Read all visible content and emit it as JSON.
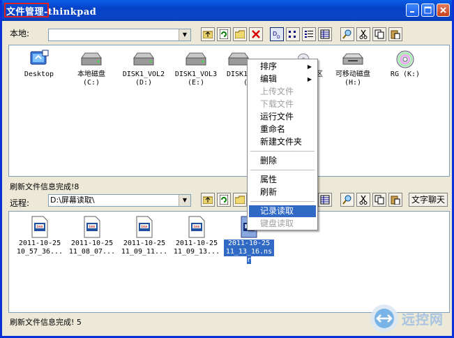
{
  "window": {
    "title_main": "文件管理",
    "title_sep": "-",
    "title_host": "thinkpad"
  },
  "local": {
    "label": "本地:",
    "path": "",
    "drives": [
      {
        "name": "Desktop",
        "letter": "",
        "icon": "desktop-icon"
      },
      {
        "name": "本地磁盘",
        "letter": "(C:)",
        "icon": "hard-drive-icon"
      },
      {
        "name": "DISK1_VOL2",
        "letter": "(D:)",
        "icon": "hard-drive-icon"
      },
      {
        "name": "DISK1_VOL3",
        "letter": "(E:)",
        "icon": "hard-drive-icon"
      },
      {
        "name": "DISK1",
        "letter": "(",
        "icon": "hard-drive-icon"
      },
      {
        "name": "区",
        "letter": "",
        "icon": "cd-drive-icon"
      },
      {
        "name": "可移动磁盘",
        "letter": "(H:)",
        "icon": "removable-drive-icon"
      },
      {
        "name": "RG (K:)",
        "letter": "",
        "icon": "cd-rom-icon"
      }
    ],
    "status": "刷新文件信息完成!8"
  },
  "remote": {
    "label": "远程:",
    "path": "D:\\屏幕读取\\",
    "chat_button": "文字聊天",
    "files": [
      {
        "line1": "2011-10-25",
        "line2": "10_57_36...",
        "line3": "",
        "selected": false
      },
      {
        "line1": "2011-10-25",
        "line2": "11_08_07...",
        "line3": "",
        "selected": false
      },
      {
        "line1": "2011-10-25",
        "line2": "11_09_11...",
        "line3": "",
        "selected": false
      },
      {
        "line1": "2011-10-25",
        "line2": "11_09_13...",
        "line3": "",
        "selected": false
      },
      {
        "line1": "2011-10-25",
        "line2": "11_13_16.ns",
        "line3": "r",
        "selected": true
      }
    ],
    "status": "刷新文件信息完成! 5"
  },
  "context_menu": {
    "items": [
      {
        "label": "排序",
        "submenu": true,
        "disabled": false
      },
      {
        "label": "编辑",
        "submenu": true,
        "disabled": false
      },
      {
        "label": "上传文件",
        "disabled": true
      },
      {
        "label": "下载文件",
        "disabled": true
      },
      {
        "label": "运行文件",
        "disabled": false
      },
      {
        "label": "重命名",
        "disabled": false
      },
      {
        "label": "新建文件夹",
        "disabled": false
      },
      {
        "label": "删除",
        "disabled": false
      },
      {
        "label": "属性",
        "disabled": false
      },
      {
        "label": "刷新",
        "disabled": false
      },
      {
        "label": "记录读取",
        "disabled": false,
        "highlighted": true
      },
      {
        "label": "键盘读取",
        "disabled": true
      }
    ]
  },
  "watermark": {
    "text": "远控网"
  },
  "colors": {
    "title_bar": "#0a4fd6",
    "selection": "#316ac5",
    "highlight_border": "#e02020"
  }
}
